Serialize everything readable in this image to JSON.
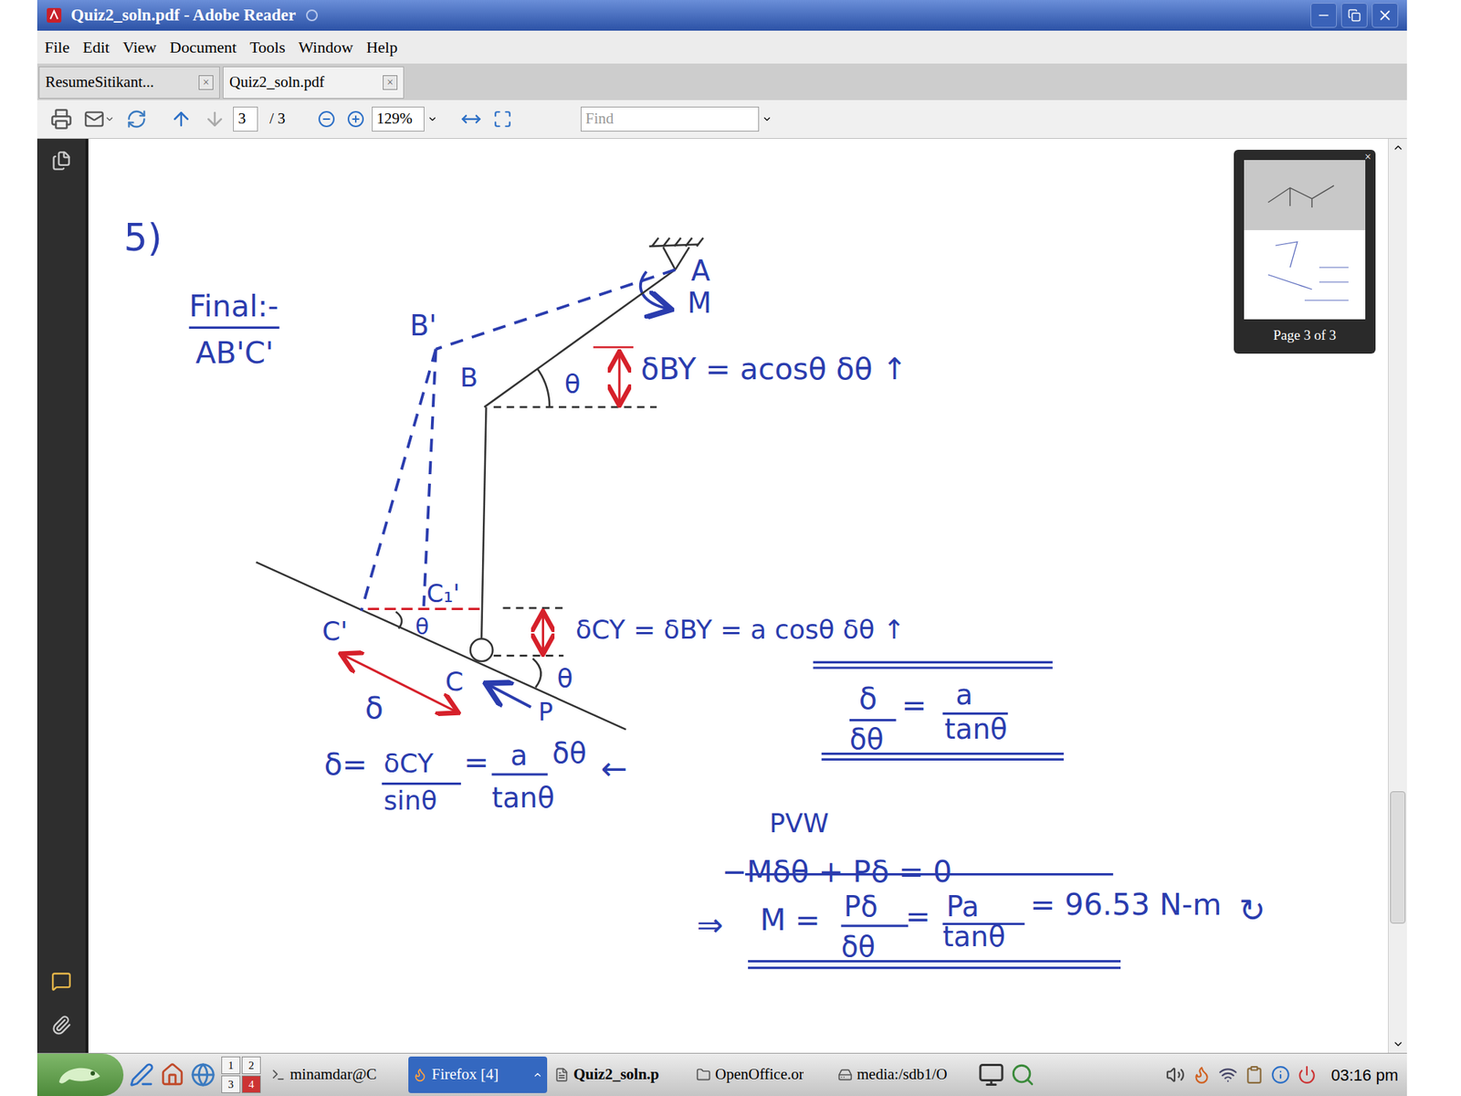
{
  "window": {
    "title": "Quiz2_soln.pdf - Adobe Reader"
  },
  "menu": [
    "File",
    "Edit",
    "View",
    "Document",
    "Tools",
    "Window",
    "Help"
  ],
  "tabs": [
    {
      "label": "ResumeSitikant...",
      "selected": false,
      "close": "×"
    },
    {
      "label": "Quiz2_soln.pdf",
      "selected": true,
      "close": "×"
    }
  ],
  "toolbar": {
    "page": "3",
    "page_total": "/ 3",
    "zoom": "129%",
    "find_placeholder": "Find"
  },
  "thumbnail": {
    "label": "Page 3 of 3",
    "close": "×"
  },
  "scrollbar": {
    "level": 0.85
  },
  "page": {
    "heading": {
      "problem": "5)",
      "final_title": "Final:-",
      "final_config": "AB'C'"
    },
    "labels": {
      "a": "A",
      "m": "M",
      "b_prime": "B'",
      "b": "B",
      "theta_b": "θ",
      "c_prime": "C'",
      "c1_prime": "C₁'",
      "theta_c_prime": "θ",
      "c": "C",
      "p": "P",
      "theta_c": "θ",
      "delta": "δ"
    },
    "delta_by": {
      "equation": "δBY = acosθ δθ ↑"
    },
    "delta_cy": {
      "equation": "δCY = δBY = a cosθ δθ ↑"
    },
    "ratio": {
      "lhs_num": "δ",
      "lhs_den": "δθ",
      "equals": "=",
      "rhs_num": "a",
      "rhs_den": "tanθ"
    },
    "delta": {
      "lhs": "δ=",
      "num": "δCY",
      "den": "sinθ",
      "equals": "=",
      "rhs_num": "a",
      "rhs_den": "tanθ",
      "factor": "δθ",
      "arrow": "←"
    },
    "pvw": {
      "title": "PVW",
      "equation": "−Mδθ + Pδ = 0"
    },
    "result": {
      "implies": "⇒",
      "lhs": "M =",
      "num1": "Pδ",
      "den1": "δθ",
      "eq1": "=",
      "num2": "Pa",
      "den2": "tanθ",
      "value": "= 96.53 N-m",
      "arrow": "↻"
    }
  },
  "taskbar": {
    "desktops": [
      {
        "label": "1",
        "selected": false
      },
      {
        "label": "2",
        "selected": false
      },
      {
        "label": "3",
        "selected": false
      },
      {
        "label": "4",
        "selected": true
      }
    ],
    "tasks": [
      {
        "label": "minamdar@C",
        "selected": false,
        "bold": false
      },
      {
        "label": "Firefox [4]",
        "selected": true,
        "bold": false
      },
      {
        "label": "Quiz2_soln.p",
        "selected": false,
        "bold": true
      },
      {
        "label": "OpenOffice.or",
        "selected": false,
        "bold": false
      },
      {
        "label": "media:/sdb1/O",
        "selected": false,
        "bold": false
      }
    ],
    "clock": "03:16 pm"
  }
}
